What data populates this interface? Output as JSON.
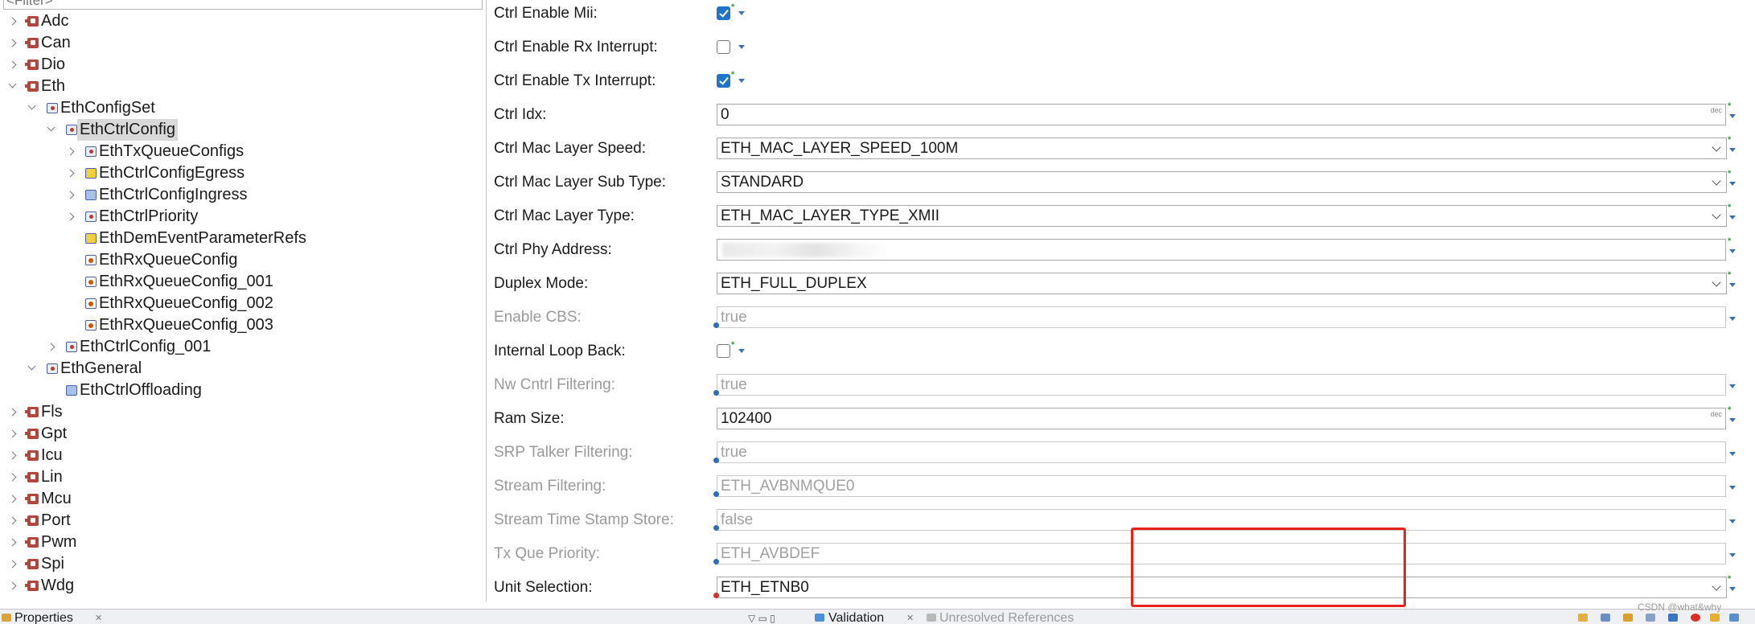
{
  "filter": {
    "placeholder": "<Filter>"
  },
  "tree": [
    {
      "label": "Adc",
      "icon": "module-icon",
      "expanded": false
    },
    {
      "label": "Can",
      "icon": "module-icon",
      "expanded": false
    },
    {
      "label": "Dio",
      "icon": "module-icon",
      "expanded": false
    },
    {
      "label": "Eth",
      "icon": "module-icon",
      "expanded": true
    },
    {
      "label": "EthConfigSet",
      "icon": "container-icon",
      "expanded": true
    },
    {
      "label": "EthCtrlConfig",
      "icon": "container-icon",
      "expanded": true,
      "selected": true
    },
    {
      "label": "EthTxQueueConfigs",
      "icon": "container-icon",
      "expanded": false
    },
    {
      "label": "EthCtrlConfigEgress",
      "icon": "reference-container-icon",
      "expanded": false
    },
    {
      "label": "EthCtrlConfigIngress",
      "icon": "param-container-icon",
      "expanded": false
    },
    {
      "label": "EthCtrlPriority",
      "icon": "container-icon",
      "expanded": false
    },
    {
      "label": "EthDemEventParameterRefs",
      "icon": "reference-container-icon"
    },
    {
      "label": "EthRxQueueConfig",
      "icon": "queue-icon"
    },
    {
      "label": "EthRxQueueConfig_001",
      "icon": "queue-icon"
    },
    {
      "label": "EthRxQueueConfig_002",
      "icon": "queue-icon"
    },
    {
      "label": "EthRxQueueConfig_003",
      "icon": "queue-icon"
    },
    {
      "label": "EthCtrlConfig_001",
      "icon": "container-icon",
      "expanded": false
    },
    {
      "label": "EthGeneral",
      "icon": "container-icon",
      "expanded": true
    },
    {
      "label": "EthCtrlOffloading",
      "icon": "param-container-icon"
    },
    {
      "label": "Fls",
      "icon": "module-icon",
      "expanded": false
    },
    {
      "label": "Gpt",
      "icon": "module-icon",
      "expanded": false
    },
    {
      "label": "Icu",
      "icon": "module-icon",
      "expanded": false
    },
    {
      "label": "Lin",
      "icon": "module-icon",
      "expanded": false
    },
    {
      "label": "Mcu",
      "icon": "module-icon",
      "expanded": false
    },
    {
      "label": "Port",
      "icon": "module-icon",
      "expanded": false
    },
    {
      "label": "Pwm",
      "icon": "module-icon",
      "expanded": false
    },
    {
      "label": "Spi",
      "icon": "module-icon",
      "expanded": false
    },
    {
      "label": "Wdg",
      "icon": "module-icon",
      "expanded": false
    }
  ],
  "properties": [
    {
      "label": "Ctrl Enable Mii:",
      "kind": "checkbox",
      "checked": true,
      "enabled": true
    },
    {
      "label": "Ctrl Enable Rx Interrupt:",
      "kind": "checkbox",
      "checked": false,
      "enabled": true
    },
    {
      "label": "Ctrl Enable Tx Interrupt:",
      "kind": "checkbox",
      "checked": true,
      "enabled": true
    },
    {
      "label": "Ctrl Idx:",
      "kind": "number",
      "value": "0",
      "unit": "dec",
      "enabled": true
    },
    {
      "label": "Ctrl Mac Layer Speed:",
      "kind": "combo",
      "value": "ETH_MAC_LAYER_SPEED_100M",
      "enabled": true
    },
    {
      "label": "Ctrl Mac Layer Sub Type:",
      "kind": "combo",
      "value": "STANDARD",
      "enabled": true
    },
    {
      "label": "Ctrl Mac Layer Type:",
      "kind": "combo",
      "value": "ETH_MAC_LAYER_TYPE_XMII",
      "enabled": true
    },
    {
      "label": "Ctrl Phy Address:",
      "kind": "text",
      "value": "",
      "redacted": true,
      "enabled": true
    },
    {
      "label": "Duplex Mode:",
      "kind": "combo",
      "value": "ETH_FULL_DUPLEX",
      "enabled": true
    },
    {
      "label": "Enable CBS:",
      "kind": "text",
      "value": "true",
      "enabled": false
    },
    {
      "label": "Internal Loop Back:",
      "kind": "checkbox",
      "checked": false,
      "enabled": true
    },
    {
      "label": "Nw Cntrl Filtering:",
      "kind": "text",
      "value": "true",
      "enabled": false
    },
    {
      "label": "Ram Size:",
      "kind": "number",
      "value": "102400",
      "unit": "dec",
      "enabled": true
    },
    {
      "label": "SRP Talker Filtering:",
      "kind": "text",
      "value": "true",
      "enabled": false
    },
    {
      "label": "Stream Filtering:",
      "kind": "text",
      "value": "ETH_AVBNMQUE0",
      "enabled": false
    },
    {
      "label": "Stream Time Stamp Store:",
      "kind": "text",
      "value": "false",
      "enabled": false
    },
    {
      "label": "Tx Que Priority:",
      "kind": "text",
      "value": "ETH_AVBDEF",
      "enabled": false
    },
    {
      "label": "Unit Selection:",
      "kind": "combo",
      "value": "ETH_ETNB0",
      "enabled": true
    }
  ],
  "bottom_tabs": {
    "properties": "Properties",
    "validation": "Validation",
    "unresolved": "Unresolved References"
  },
  "watermark": "CSDN @what&why",
  "colors": {
    "highlight": "#e5221b",
    "checkbox": "#1f73c9",
    "module_icon": "#b3463b"
  }
}
